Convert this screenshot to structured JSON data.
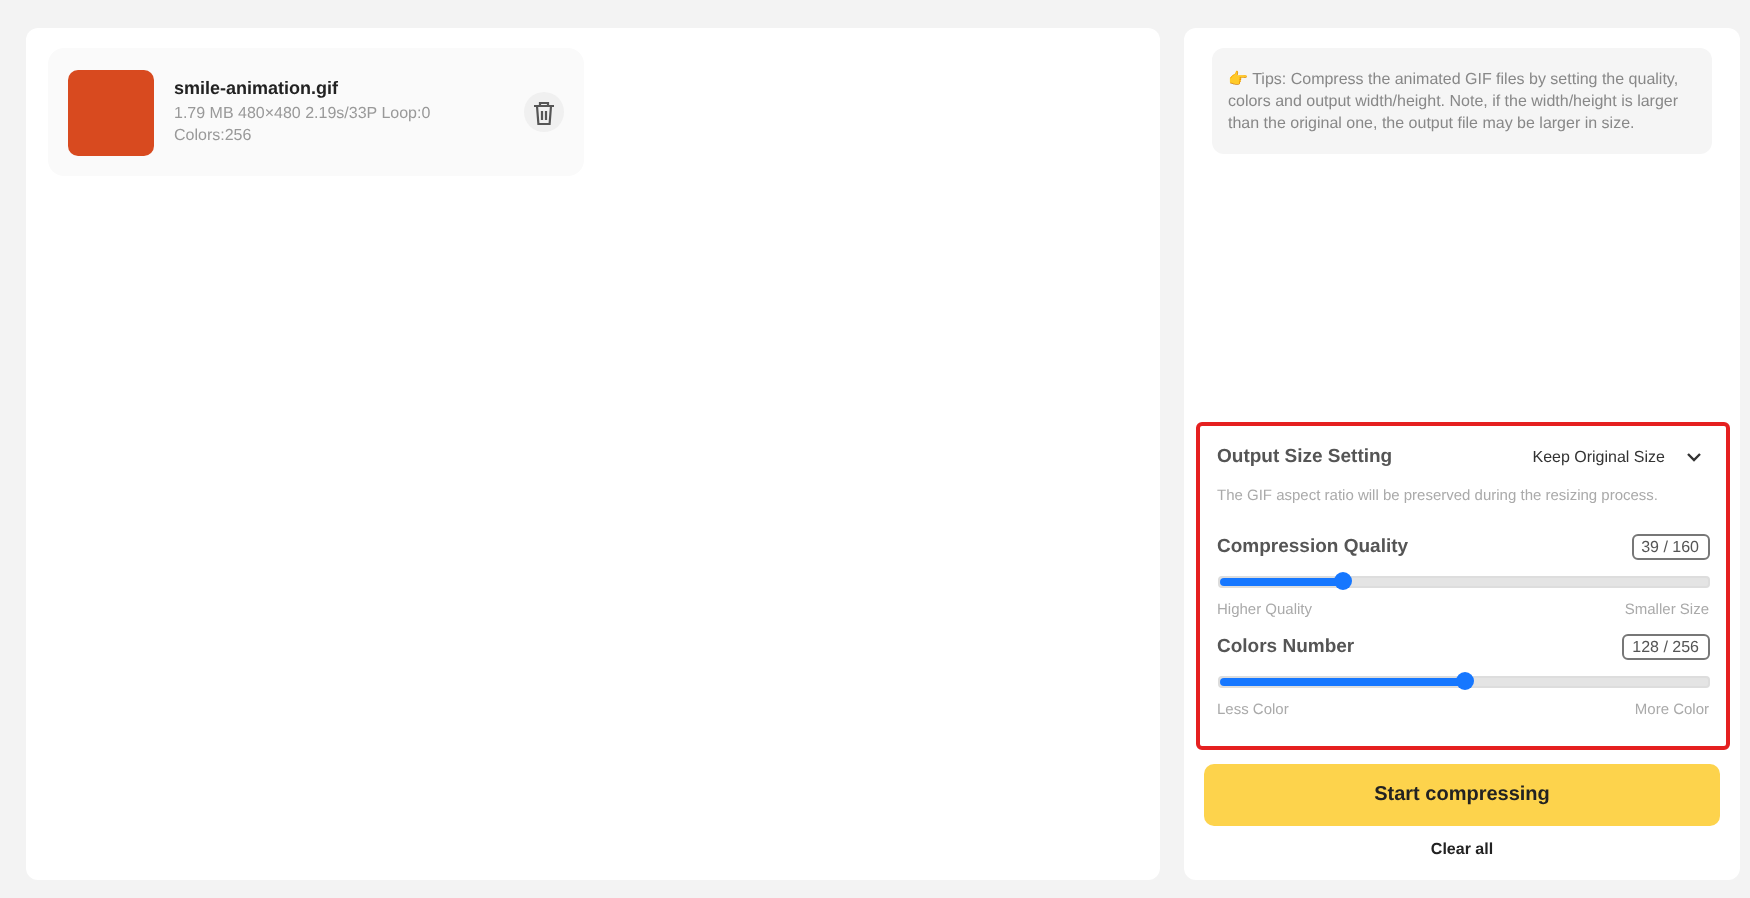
{
  "files": [
    {
      "name": "smile-animation.gif",
      "meta": "1.79 MB 480×480 2.19s/33P Loop:0",
      "colors": "Colors:256"
    }
  ],
  "tips": {
    "icon": "👉",
    "text": "Tips: Compress the animated GIF files by setting the quality, colors and output width/height. Note, if the width/height is larger than the original one, the output file may be larger in size."
  },
  "settings": {
    "highlighted": true,
    "output_size": {
      "label": "Output Size Setting",
      "value": "Keep Original Size",
      "note": "The GIF aspect ratio will be preserved during the resizing process."
    },
    "sliders": [
      {
        "label": "Compression Quality",
        "reading": "39 / 160",
        "level": 0.25,
        "min_label": "Higher Quality",
        "max_label": "Smaller Size"
      },
      {
        "label": "Colors Number",
        "reading": "128 / 256",
        "level": 0.5,
        "min_label": "Less Color",
        "max_label": "More Color"
      }
    ]
  },
  "buttons": {
    "primary": "Start compressing",
    "secondary": "Clear all"
  }
}
